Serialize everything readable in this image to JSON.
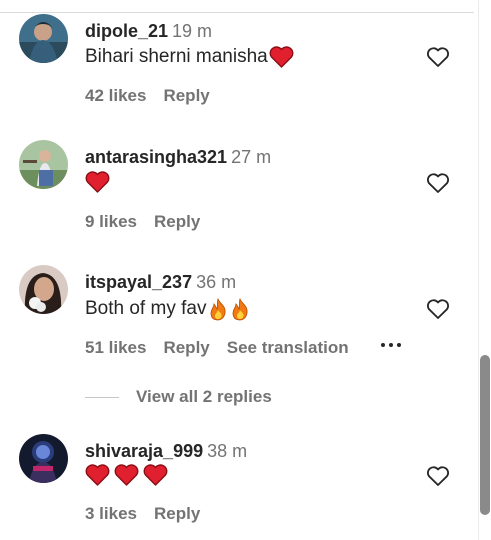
{
  "comments": [
    {
      "username": "dipole_21",
      "time": "19 m",
      "text": "Bihari sherni manisha",
      "emojis": [
        "heart"
      ],
      "likes": "42 likes",
      "reply": "Reply"
    },
    {
      "username": "antarasingha321",
      "time": "27 m",
      "text": "",
      "emojis": [
        "heart"
      ],
      "likes": "9 likes",
      "reply": "Reply"
    },
    {
      "username": "itspayal_237",
      "time": "36 m",
      "text": "Both of my fav",
      "emojis": [
        "fire",
        "fire"
      ],
      "likes": "51 likes",
      "reply": "Reply",
      "translation": "See translation",
      "view_replies": "View all 2 replies"
    },
    {
      "username": "shivaraja_999",
      "time": "38 m",
      "text": "",
      "emojis": [
        "heart",
        "heart",
        "heart"
      ],
      "likes": "3 likes",
      "reply": "Reply"
    }
  ],
  "icons": {
    "like": "heart-outline-icon",
    "more": "more-options-icon",
    "emoji_heart": "red-heart-emoji",
    "emoji_fire": "fire-emoji"
  },
  "colors": {
    "text_primary": "#262626",
    "text_secondary": "#737373",
    "heart_red": "#e0202e",
    "divider": "#dbdbdb"
  }
}
